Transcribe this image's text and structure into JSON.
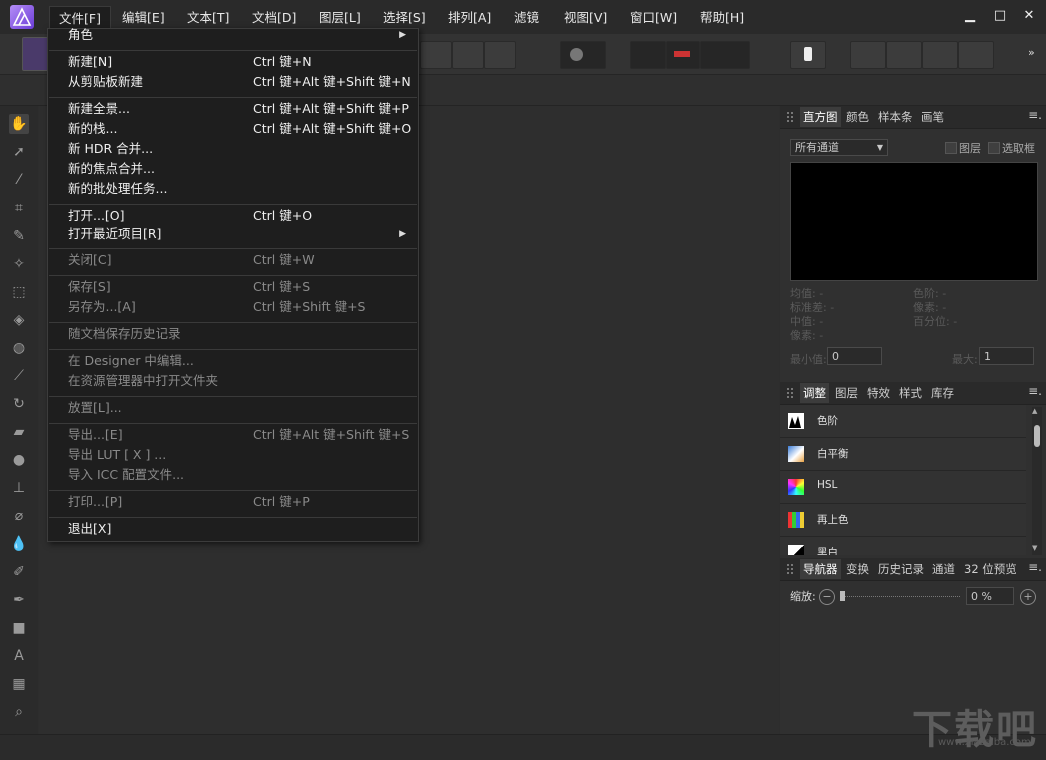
{
  "menubar": {
    "items": [
      "文件[F]",
      "编辑[E]",
      "文本[T]",
      "文档[D]",
      "图层[L]",
      "选择[S]",
      "排列[A]",
      "滤镜",
      "视图[V]",
      "窗口[W]",
      "帮助[H]"
    ],
    "minimize": "▁",
    "maximize": "□",
    "close": "✕"
  },
  "file_menu": {
    "items": [
      {
        "label": "角色",
        "shortcut": "",
        "submenu": true,
        "disabled": false
      },
      {
        "label": "新建[N]",
        "shortcut": "Ctrl 键+N",
        "disabled": false
      },
      {
        "label": "从剪贴板新建",
        "shortcut": "Ctrl 键+Alt 键+Shift 键+N",
        "disabled": false
      },
      {
        "label": "新建全景...",
        "shortcut": "Ctrl 键+Alt 键+Shift 键+P",
        "disabled": false
      },
      {
        "label": "新的栈...",
        "shortcut": "Ctrl 键+Alt 键+Shift 键+O",
        "disabled": false
      },
      {
        "label": "新 HDR 合并...",
        "shortcut": "",
        "disabled": false
      },
      {
        "label": "新的焦点合并...",
        "shortcut": "",
        "disabled": false
      },
      {
        "label": "新的批处理任务...",
        "shortcut": "",
        "disabled": false
      },
      {
        "label": "打开...[O]",
        "shortcut": "Ctrl 键+O",
        "disabled": false
      },
      {
        "label": "打开最近项目[R]",
        "shortcut": "",
        "submenu": true,
        "disabled": false
      },
      {
        "label": "关闭[C]",
        "shortcut": "Ctrl 键+W",
        "disabled": true
      },
      {
        "label": "保存[S]",
        "shortcut": "Ctrl 键+S",
        "disabled": true
      },
      {
        "label": "另存为...[A]",
        "shortcut": "Ctrl 键+Shift 键+S",
        "disabled": true
      },
      {
        "label": "随文档保存历史记录",
        "shortcut": "",
        "disabled": true
      },
      {
        "label": "在 Designer 中编辑...",
        "shortcut": "",
        "disabled": true
      },
      {
        "label": "在资源管理器中打开文件夹",
        "shortcut": "",
        "disabled": true
      },
      {
        "label": "放置[L]...",
        "shortcut": "",
        "disabled": true
      },
      {
        "label": "导出...[E]",
        "shortcut": "Ctrl 键+Alt 键+Shift 键+S",
        "disabled": true
      },
      {
        "label": "导出 LUT [ X ] ...",
        "shortcut": "",
        "disabled": true
      },
      {
        "label": "导入 ICC 配置文件...",
        "shortcut": "",
        "disabled": true
      },
      {
        "label": "打印...[P]",
        "shortcut": "Ctrl 键+P",
        "disabled": true
      },
      {
        "label": "退出[X]",
        "shortcut": "",
        "disabled": false
      }
    ]
  },
  "histogram_panel": {
    "tabs": [
      "直方图",
      "颜色",
      "样本条",
      "画笔"
    ],
    "channel": "所有通道",
    "layer_checkbox": "图层",
    "selection_checkbox": "选取框",
    "stats_left": [
      "均值: -",
      "标准差: -",
      "中值: -",
      "像素: -"
    ],
    "stats_right": [
      "色阶: -",
      "像素: -",
      "百分位: -"
    ],
    "min_label": "最小值:",
    "min_value": "0",
    "max_label": "最大:",
    "max_value": "1"
  },
  "adjust_panel": {
    "tabs": [
      "调整",
      "图层",
      "特效",
      "样式",
      "库存"
    ],
    "items": [
      "色阶",
      "白平衡",
      "HSL",
      "再上色",
      "黑白"
    ]
  },
  "navigator_panel": {
    "tabs": [
      "导航器",
      "变换",
      "历史记录",
      "通道",
      "32 位预览"
    ],
    "zoom_label": "缩放:",
    "zoom_value": "0 %"
  },
  "watermark": {
    "text": "下载吧",
    "sub": "www.xiazaiba.com"
  },
  "colors": {
    "accent": "#8a5cf0",
    "menu_bg": "#1e1e1e",
    "panel_bg": "#303030"
  }
}
